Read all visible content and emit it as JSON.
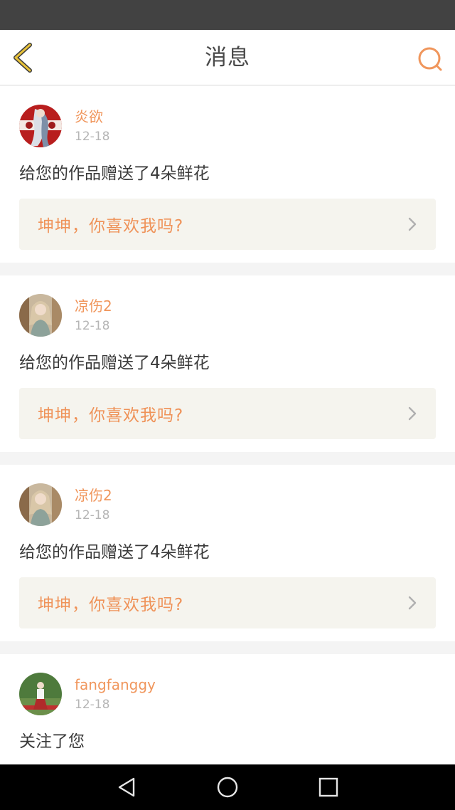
{
  "header": {
    "title": "消息",
    "back_icon": "chevron-left-icon",
    "search_icon": "search-icon",
    "accent": "#f0965c",
    "back_color": "#e8c23a"
  },
  "messages": [
    {
      "name": "炎欲",
      "date": "12-18",
      "action": "给您的作品赠送了4朵鲜花",
      "quote": "坤坤，你喜欢我吗?"
    },
    {
      "name": "凉伤2",
      "date": "12-18",
      "action": "给您的作品赠送了4朵鲜花",
      "quote": "坤坤，你喜欢我吗?"
    },
    {
      "name": "凉伤2",
      "date": "12-18",
      "action": "给您的作品赠送了4朵鲜花",
      "quote": "坤坤，你喜欢我吗?"
    },
    {
      "name": "fangfanggy",
      "date": "12-18",
      "action": "关注了您"
    }
  ],
  "nav": {
    "back_icon": "triangle-back-icon",
    "home_icon": "circle-home-icon",
    "recents_icon": "square-recents-icon"
  }
}
